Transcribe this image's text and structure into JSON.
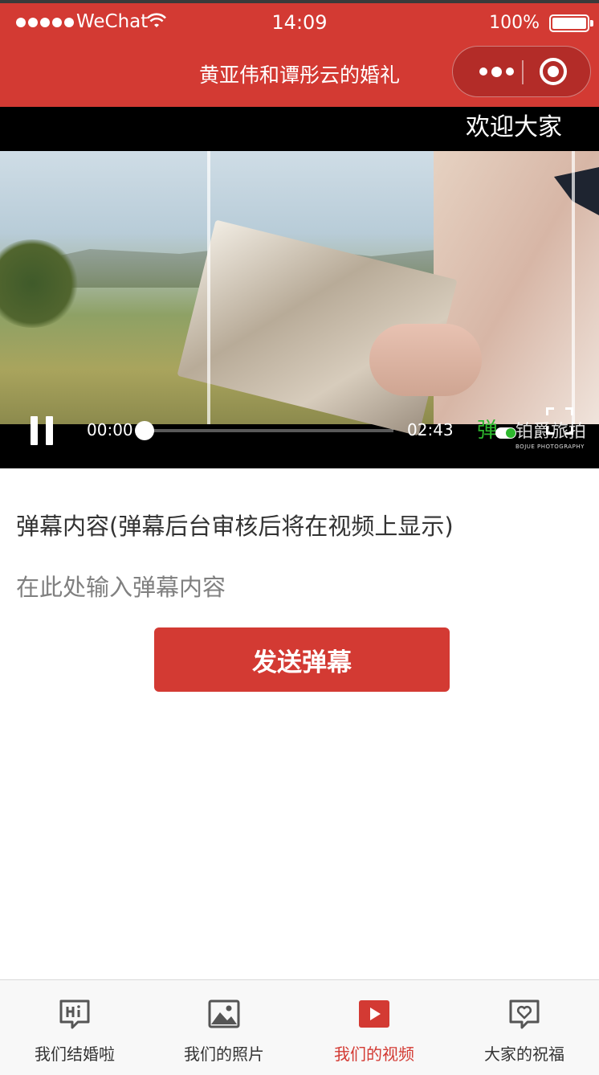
{
  "status_bar": {
    "carrier": "WeChat",
    "time": "14:09",
    "battery": "100%"
  },
  "nav": {
    "title": "黄亚伟和谭彤云的婚礼"
  },
  "video": {
    "flying_danmaku": "欢迎大家",
    "current_time": "00:00",
    "duration": "02:43",
    "progress": 0,
    "danmaku_toggle_label": "弹",
    "watermark_cn": "铂爵旅拍",
    "watermark_en": "BOJUE PHOTOGRAPHY"
  },
  "form": {
    "label": "弹幕内容(弹幕后台审核后将在视频上显示)",
    "input_placeholder": "在此处输入弹幕内容",
    "input_value": "",
    "send_label": "发送弹幕"
  },
  "colors": {
    "brand": "#d33a33",
    "tab_inactive": "#555555"
  },
  "tabbar": {
    "items": [
      {
        "label": "我们结婚啦",
        "icon": "hi-chat-icon",
        "active": false
      },
      {
        "label": "我们的照片",
        "icon": "photo-icon",
        "active": false
      },
      {
        "label": "我们的视频",
        "icon": "video-play-icon",
        "active": true
      },
      {
        "label": "大家的祝福",
        "icon": "heart-chat-icon",
        "active": false
      }
    ]
  }
}
